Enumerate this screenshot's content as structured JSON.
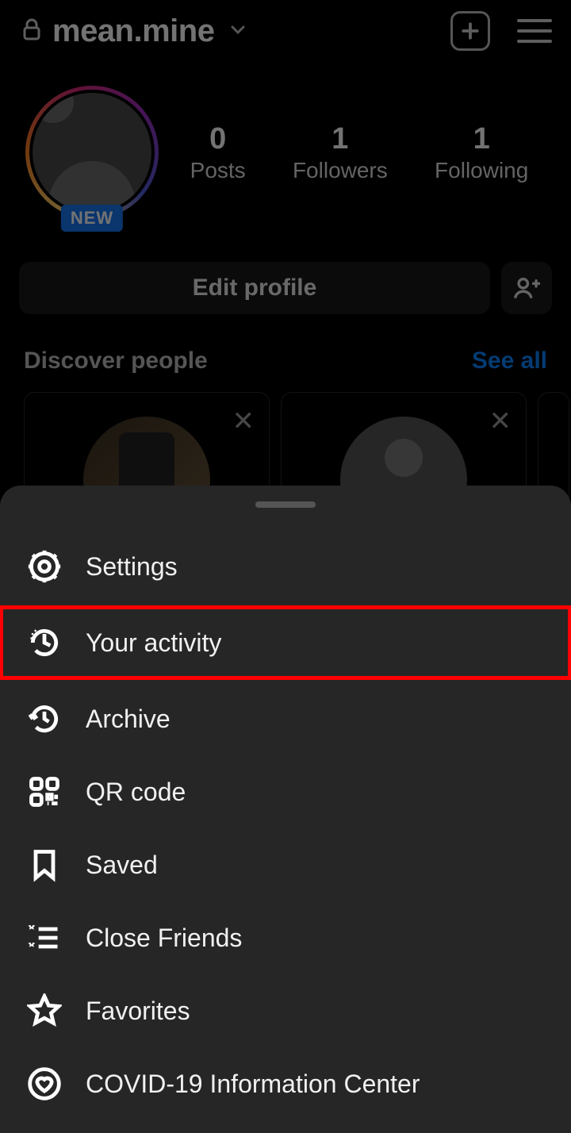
{
  "header": {
    "username": "mean.mine"
  },
  "profile": {
    "new_badge": "NEW",
    "stats": [
      {
        "value": "0",
        "label": "Posts"
      },
      {
        "value": "1",
        "label": "Followers"
      },
      {
        "value": "1",
        "label": "Following"
      }
    ]
  },
  "buttons": {
    "edit_profile": "Edit profile"
  },
  "discover": {
    "title": "Discover people",
    "see_all": "See all"
  },
  "menu": {
    "items": [
      {
        "label": "Settings",
        "icon": "gear-icon",
        "highlight": false
      },
      {
        "label": "Your activity",
        "icon": "activity-icon",
        "highlight": true
      },
      {
        "label": "Archive",
        "icon": "archive-icon",
        "highlight": false
      },
      {
        "label": "QR code",
        "icon": "qrcode-icon",
        "highlight": false
      },
      {
        "label": "Saved",
        "icon": "bookmark-icon",
        "highlight": false
      },
      {
        "label": "Close Friends",
        "icon": "closefriends-icon",
        "highlight": false
      },
      {
        "label": "Favorites",
        "icon": "star-icon",
        "highlight": false
      },
      {
        "label": "COVID-19 Information Center",
        "icon": "heart-circle-icon",
        "highlight": false
      }
    ]
  }
}
